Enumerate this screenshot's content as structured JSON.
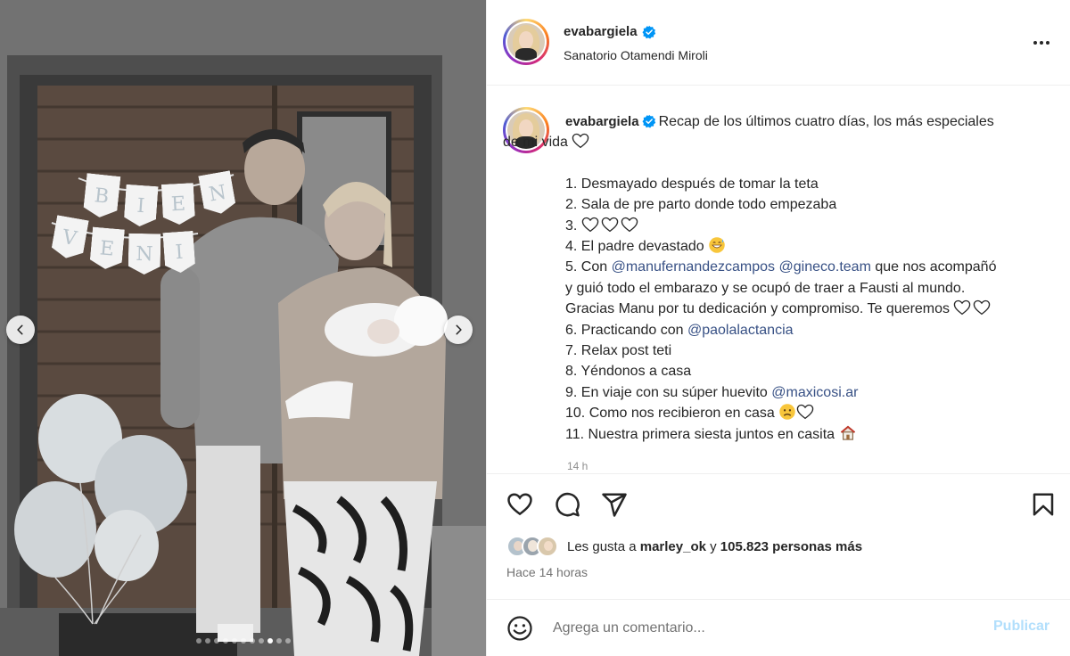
{
  "post": {
    "username": "evabargiela",
    "verified": true,
    "location": "Sanatorio Otamendi Miroli",
    "more_icon": "more-horizontal-icon"
  },
  "photo": {
    "sign_letters_row1": [
      "B",
      "I",
      "E",
      "N"
    ],
    "sign_letters_row2": [
      "V",
      "E",
      "N",
      "I"
    ],
    "carousel": {
      "total_slides": 11,
      "active_slide": 9
    }
  },
  "caption": {
    "username": "evabargiela",
    "first_line_rest": "Recap de los últimos cuatro días, los más especiales",
    "second_line": "de mi vida",
    "items": {
      "i1": "1. Desmayado después de tomar la teta",
      "i2": "2. Sala de pre parto donde todo empezaba",
      "i3": "3.",
      "i4": "4. El padre devastado",
      "i5_prefix": "5. Con",
      "i5_mention1": "@manufernandezcampos",
      "i5_mention2": "@gineco.team",
      "i5_suffix": "que nos acompañó",
      "i5_line2": "y guió todo el embarazo y se ocupó de traer a Fausti al mundo.",
      "i5_line3": "Gracias Manu por tu dedicación y compromiso. Te queremos",
      "i6_prefix": "6. Practicando con",
      "i6_mention": "@paolalactancia",
      "i7": "7. Relax post teti",
      "i8": "8. Yéndonos a casa",
      "i9_prefix": "9. En viaje con su súper huevito",
      "i9_mention": "@maxicosi.ar",
      "i10": "10. Como nos recibieron en casa",
      "i11": "11. Nuestra primera siesta juntos en casita"
    },
    "time_ago": "14 h"
  },
  "actions": {
    "like_icon": "heart-icon",
    "comment_icon": "comment-icon",
    "share_icon": "share-icon",
    "save_icon": "bookmark-icon"
  },
  "likes": {
    "prefix": "Les gusta a",
    "user": "marley_ok",
    "connector": "y",
    "count": "105.823 personas más"
  },
  "post_time": "Hace 14 horas",
  "comment": {
    "placeholder": "Agrega un comentario...",
    "publish_label": "Publicar",
    "emoji_icon": "smiley-icon"
  },
  "colors": {
    "text": "#262626",
    "mention": "#385185",
    "secondary": "#737373",
    "verified": "#0095f6",
    "publish_disabled": "#b2dffc"
  }
}
